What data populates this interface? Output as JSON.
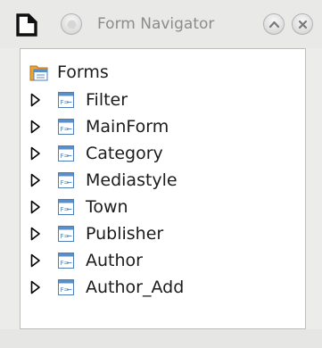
{
  "window": {
    "title": "Form Navigator",
    "controls": [
      "minimize-icon",
      "maximize-icon",
      "close-icon"
    ]
  },
  "tree": {
    "root": {
      "label": "Forms",
      "icon": "forms-folder-icon"
    },
    "items": [
      {
        "label": "Filter",
        "icon": "form-icon"
      },
      {
        "label": "MainForm",
        "icon": "form-icon"
      },
      {
        "label": "Category",
        "icon": "form-icon"
      },
      {
        "label": "Mediastyle",
        "icon": "form-icon"
      },
      {
        "label": "Town",
        "icon": "form-icon"
      },
      {
        "label": "Publisher",
        "icon": "form-icon"
      },
      {
        "label": "Author",
        "icon": "form-icon"
      },
      {
        "label": "Author_Add",
        "icon": "form-icon"
      }
    ]
  },
  "colors": {
    "window_bg": "#ececeb",
    "panel_bg": "#ffffff",
    "title_text": "#8c8c8c",
    "folder": "#e8a33b",
    "form_icon_blue": "#5b8fc7"
  }
}
